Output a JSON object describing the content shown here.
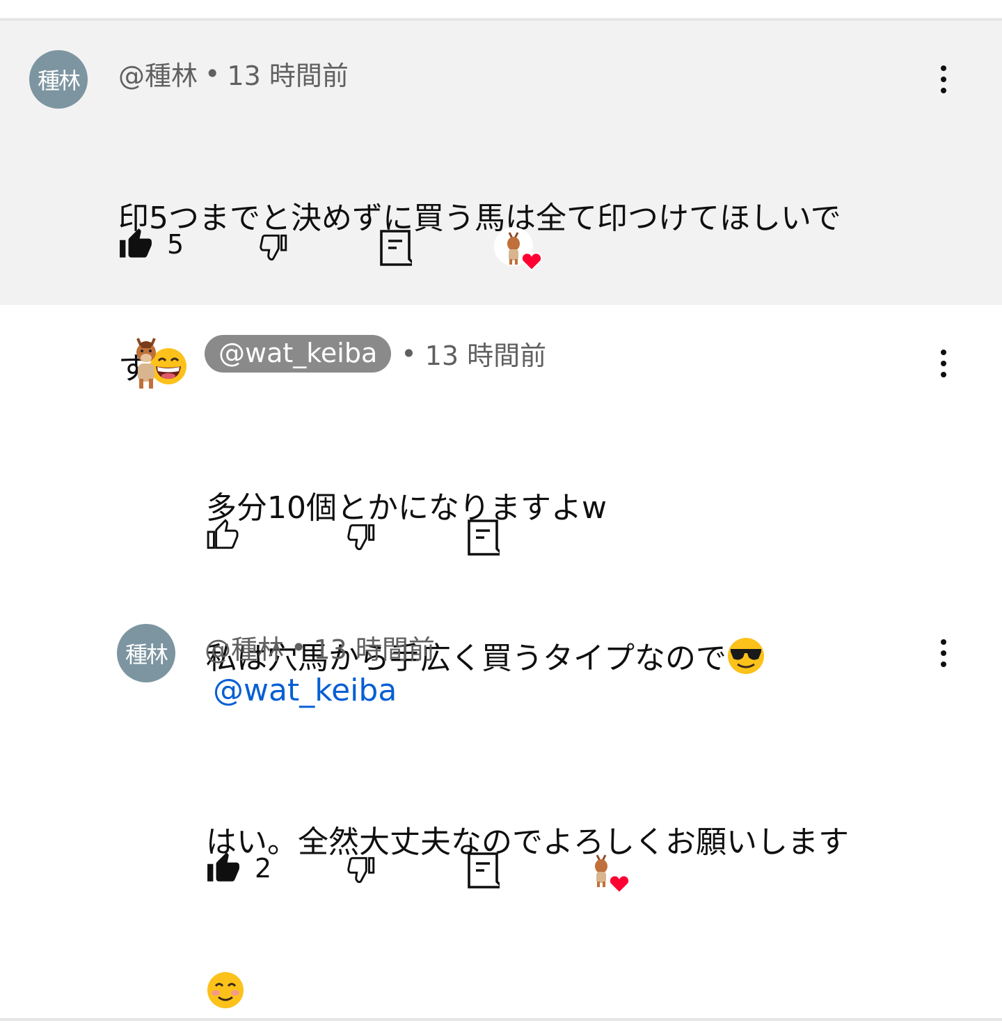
{
  "comments": [
    {
      "avatar_text": "種林",
      "author": "@種林",
      "time": "13 時間前",
      "line1": "印5つまでと決めずに買う馬は全て印つけてほしいで",
      "line2": "す",
      "line2_emoji": "grinning-face",
      "likes": "5",
      "hearted": true
    },
    {
      "author": "@wat_keiba",
      "time": "13 時間前",
      "line1": "多分10個とかになりますよw",
      "line2": "私は穴馬から手広く買うタイプなので",
      "line2_emoji": "sunglasses-face",
      "likes": ""
    },
    {
      "avatar_text": "種林",
      "author": "@種林",
      "time": "13 時間前",
      "mention": "@wat_keiba",
      "line1": "はい。全然大丈夫なのでよろしくお願いします",
      "line2_emoji": "smiling-face",
      "likes": "2",
      "hearted": true
    }
  ],
  "dot": "•"
}
